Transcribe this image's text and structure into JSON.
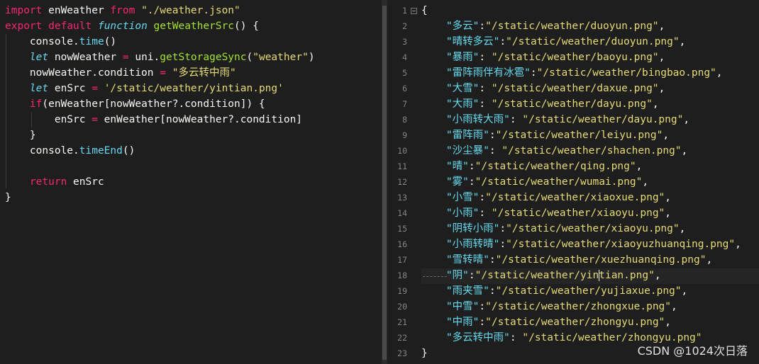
{
  "left_editor": {
    "lines": [
      [
        [
          "import",
          "kw"
        ],
        [
          " enWeather ",
          "id"
        ],
        [
          "from",
          "kw"
        ],
        [
          " ",
          "id"
        ],
        [
          "\"./weather.json\"",
          "str"
        ]
      ],
      [
        [
          "export",
          "kw"
        ],
        [
          " ",
          "id"
        ],
        [
          "default",
          "kw"
        ],
        [
          " ",
          "id"
        ],
        [
          "function",
          "it"
        ],
        [
          " ",
          "id"
        ],
        [
          "getWeatherSrc",
          "fn"
        ],
        [
          "() {",
          "id"
        ]
      ],
      [
        [
          "    console.",
          "id"
        ],
        [
          "time",
          "method"
        ],
        [
          "()",
          "id"
        ]
      ],
      [
        [
          "    ",
          "id"
        ],
        [
          "let",
          "it"
        ],
        [
          " nowWeather ",
          "id"
        ],
        [
          "=",
          "op"
        ],
        [
          " uni.",
          "id"
        ],
        [
          "getStorageSync",
          "fn"
        ],
        [
          "(",
          "id"
        ],
        [
          "\"weather\"",
          "str"
        ],
        [
          ")",
          "id"
        ]
      ],
      [
        [
          "    nowWeather.condition ",
          "id"
        ],
        [
          "=",
          "op"
        ],
        [
          " ",
          "id"
        ],
        [
          "\"多云转中雨\"",
          "str"
        ]
      ],
      [
        [
          "    ",
          "id"
        ],
        [
          "let",
          "it"
        ],
        [
          " enSrc ",
          "id"
        ],
        [
          "=",
          "op"
        ],
        [
          " ",
          "id"
        ],
        [
          "'/static/weather/yintian.png'",
          "str"
        ]
      ],
      [
        [
          "    ",
          "id"
        ],
        [
          "if",
          "kw"
        ],
        [
          "(enWeather[nowWeather?.condition]) {",
          "id"
        ]
      ],
      [
        [
          "        enSrc ",
          "id"
        ],
        [
          "=",
          "op"
        ],
        [
          " enWeather[nowWeather?.condition]",
          "id"
        ]
      ],
      [
        [
          "    }",
          "id"
        ]
      ],
      [
        [
          "    console.",
          "id"
        ],
        [
          "timeEnd",
          "method"
        ],
        [
          "()",
          "id"
        ]
      ],
      [
        [
          "",
          "id"
        ]
      ],
      [
        [
          "    ",
          "id"
        ],
        [
          "return",
          "kw"
        ],
        [
          " enSrc",
          "id"
        ]
      ],
      [
        [
          "}",
          "id"
        ]
      ]
    ]
  },
  "right_editor": {
    "line_numbers": [
      "1",
      "2",
      "3",
      "4",
      "5",
      "6",
      "7",
      "8",
      "9",
      "10",
      "11",
      "12",
      "13",
      "14",
      "15",
      "16",
      "17",
      "18",
      "19",
      "20",
      "21",
      "22",
      "23"
    ],
    "open_brace": "{",
    "close_brace": "}",
    "entries": [
      {
        "key": "\"多云\"",
        "sep": ":",
        "val": "\"/static/weather/duoyun.png\"",
        "end": ","
      },
      {
        "key": "\"晴转多云\"",
        "sep": ":",
        "val": "\"/static/weather/duoyun.png\"",
        "end": ","
      },
      {
        "key": "\"暴雨\"",
        "sep": ": ",
        "val": "\"/static/weather/baoyu.png\"",
        "end": ","
      },
      {
        "key": "\"雷阵雨伴有冰雹\"",
        "sep": ":",
        "val": "\"/static/weather/bingbao.png\"",
        "end": ","
      },
      {
        "key": "\"大雪\"",
        "sep": ": ",
        "val": "\"/static/weather/daxue.png\"",
        "end": ","
      },
      {
        "key": "\"大雨\"",
        "sep": ": ",
        "val": "\"/static/weather/dayu.png\"",
        "end": ","
      },
      {
        "key": "\"小雨转大雨\"",
        "sep": ": ",
        "val": "\"/static/weather/dayu.png\"",
        "end": ","
      },
      {
        "key": "\"雷阵雨\"",
        "sep": ":",
        "val": "\"/static/weather/leiyu.png\"",
        "end": ","
      },
      {
        "key": "\"沙尘暴\"",
        "sep": ": ",
        "val": "\"/static/weather/shachen.png\"",
        "end": ","
      },
      {
        "key": "\"晴\"",
        "sep": ":",
        "val": "\"/static/weather/qing.png\"",
        "end": ","
      },
      {
        "key": "\"雾\"",
        "sep": ":",
        "val": "\"/static/weather/wumai.png\"",
        "end": ","
      },
      {
        "key": "\"小雪\"",
        "sep": ":",
        "val": "\"/static/weather/xiaoxue.png\"",
        "end": ","
      },
      {
        "key": "\"小雨\"",
        "sep": ": ",
        "val": "\"/static/weather/xiaoyu.png\"",
        "end": ","
      },
      {
        "key": "\"阴转小雨\"",
        "sep": ":",
        "val": "\"/static/weather/xiaoyu.png\"",
        "end": ","
      },
      {
        "key": "\"小雨转晴\"",
        "sep": ":",
        "val": "\"/static/weather/xiaoyuzhuanqing.png\"",
        "end": ","
      },
      {
        "key": "\"雪转晴\"",
        "sep": ":",
        "val": "\"/static/weather/xuezhuanqing.png\"",
        "end": ","
      },
      {
        "key": "\"阴\"",
        "sep": ":",
        "val": "\"/static/weather/yintian.png\"",
        "end": ","
      },
      {
        "key": "\"雨夹雪\"",
        "sep": ":",
        "val": "\"/static/weather/yujiaxue.png\"",
        "end": ","
      },
      {
        "key": "\"中雪\"",
        "sep": ":",
        "val": "\"/static/weather/zhongxue.png\"",
        "end": ","
      },
      {
        "key": "\"中雨\"",
        "sep": ":",
        "val": "\"/static/weather/zhongyu.png\"",
        "end": ","
      },
      {
        "key": "\"多云转中雨\"",
        "sep": ": ",
        "val": "\"/static/weather/zhongyu.png\"",
        "end": ""
      }
    ]
  },
  "watermark": "CSDN @1024次日落"
}
